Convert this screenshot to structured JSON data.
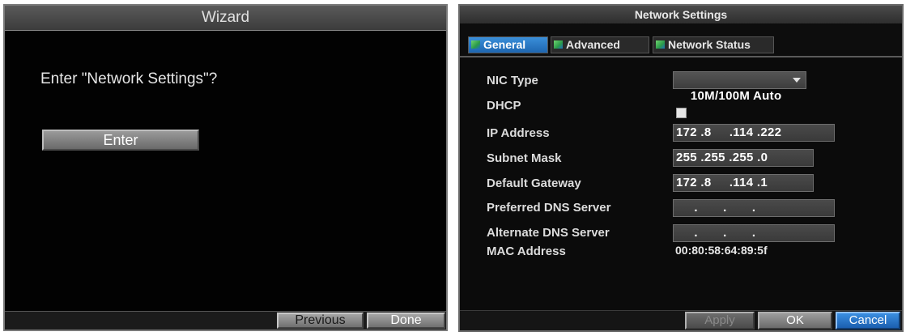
{
  "wizard": {
    "title": "Wizard",
    "question": "Enter \"Network Settings\"?",
    "enter_label": "Enter",
    "previous_label": "Previous",
    "done_label": "Done"
  },
  "network": {
    "title": "Network Settings",
    "tabs": [
      {
        "label": "General",
        "active": true
      },
      {
        "label": "Advanced",
        "active": false
      },
      {
        "label": "Network Status",
        "active": false
      }
    ],
    "fields": {
      "nic_type": {
        "label": "NIC Type",
        "value": "10M/100M Auto"
      },
      "dhcp": {
        "label": "DHCP",
        "checked": false
      },
      "ip_address": {
        "label": "IP Address",
        "value": "172 .8     .114 .222"
      },
      "subnet_mask": {
        "label": "Subnet Mask",
        "value": "255 .255 .255 .0"
      },
      "default_gateway": {
        "label": "Default Gateway",
        "value": "172 .8     .114 .1"
      },
      "preferred_dns": {
        "label": "Preferred DNS Server",
        "value": "     .       .       ."
      },
      "alternate_dns": {
        "label": "Alternate DNS Server",
        "value": "     .       .       ."
      },
      "mac_address": {
        "label": "MAC Address",
        "value": "00:80:58:64:89:5f"
      }
    },
    "buttons": {
      "apply": "Apply",
      "ok": "OK",
      "cancel": "Cancel"
    }
  },
  "colors": {
    "panel_bg": "#020202",
    "active_tab": "#2a7acc",
    "cancel_button": "#2a7acc"
  }
}
